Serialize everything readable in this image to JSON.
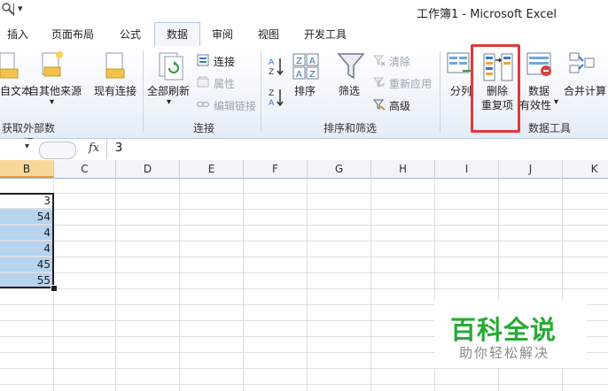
{
  "window": {
    "title": "工作簿1  -  Microsoft Excel"
  },
  "tabs": [
    "插入",
    "页面布局",
    "公式",
    "数据",
    "审阅",
    "视图",
    "开发工具"
  ],
  "active_tab": "数据",
  "ribbon": {
    "get_external": {
      "from_text": "自文本",
      "from_other": "自其他来源",
      "existing_connections": "现有连接",
      "group_label": "获取外部数据"
    },
    "connections": {
      "refresh_all": "全部刷新",
      "connections": "连接",
      "properties": "属性",
      "edit_links": "编辑链接",
      "group_label": "连接"
    },
    "sort_filter": {
      "sort": "排序",
      "filter": "筛选",
      "clear": "清除",
      "reapply": "重新应用",
      "advanced": "高级",
      "group_label": "排序和筛选"
    },
    "data_tools": {
      "text_to_columns": "分列",
      "remove_duplicates_line1": "删除",
      "remove_duplicates_line2": "重复项",
      "validation_line1": "数据",
      "validation_line2": "有效性",
      "consolidate": "合并计算",
      "group_label": "数据工具"
    }
  },
  "formula_bar": {
    "fx": "fx",
    "value": "3"
  },
  "columns": [
    "B",
    "C",
    "D",
    "E",
    "F",
    "G",
    "H",
    "I",
    "J",
    "K"
  ],
  "selected_column": "B",
  "column_b_values": [
    "3",
    "54",
    "4",
    "4",
    "45",
    "55"
  ],
  "watermark": {
    "title": "百科全说",
    "subtitle": "助你轻松解决"
  },
  "colors": {
    "highlight": "#e0383d",
    "selection": "#b7d3ee",
    "watermark_green": "#29a936"
  }
}
